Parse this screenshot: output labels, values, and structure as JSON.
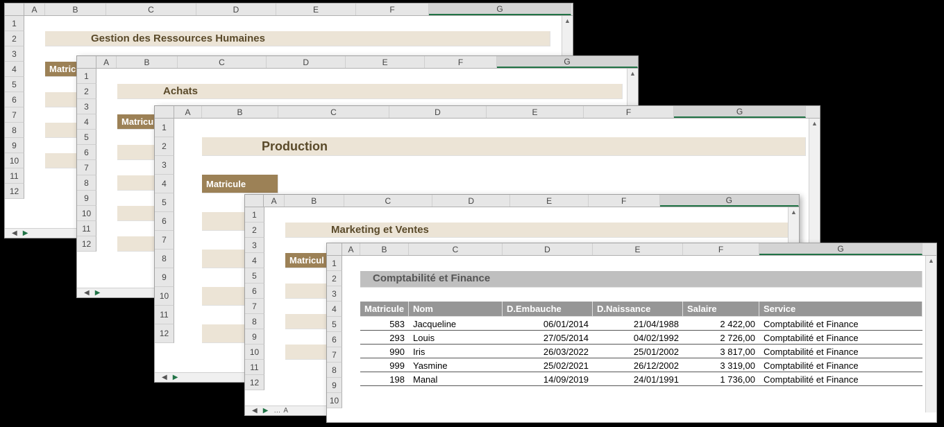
{
  "columns": [
    "A",
    "B",
    "C",
    "D",
    "E",
    "F",
    "G"
  ],
  "rows12": [
    "1",
    "2",
    "3",
    "4",
    "5",
    "6",
    "7",
    "8",
    "9",
    "10",
    "11",
    "12"
  ],
  "rows10": [
    "1",
    "2",
    "3",
    "4",
    "5",
    "6",
    "7",
    "8",
    "9",
    "10"
  ],
  "w1": {
    "title": "Gestion des Ressources Humaines",
    "header_b": "Matricule"
  },
  "w2": {
    "title": "Achats",
    "header_b": "Matricule"
  },
  "w3": {
    "title": "Production",
    "header_b": "Matricule"
  },
  "w4": {
    "title": "Marketing et Ventes",
    "header_b": "Matricul"
  },
  "w5": {
    "title": "Comptabilité et Finance",
    "headers": {
      "b": "Matricule",
      "c": "Nom",
      "d": "D.Embauche",
      "e": "D.Naissance",
      "f": "Salaire",
      "g": "Service"
    },
    "rows": [
      {
        "mat": "583",
        "nom": "Jacqueline",
        "emb": "06/01/2014",
        "nai": "21/04/1988",
        "sal": "2 422,00",
        "srv": "Comptabilité et Finance"
      },
      {
        "mat": "293",
        "nom": "Louis",
        "emb": "27/05/2014",
        "nai": "04/02/1992",
        "sal": "2 726,00",
        "srv": "Comptabilité et Finance"
      },
      {
        "mat": "990",
        "nom": "Iris",
        "emb": "26/03/2022",
        "nai": "25/01/2002",
        "sal": "3 817,00",
        "srv": "Comptabilité et Finance"
      },
      {
        "mat": "999",
        "nom": "Yasmine",
        "emb": "25/02/2021",
        "nai": "26/12/2002",
        "sal": "3 319,00",
        "srv": "Comptabilité et Finance"
      },
      {
        "mat": "198",
        "nom": "Manal",
        "emb": "14/09/2019",
        "nai": "24/01/1991",
        "sal": "1 736,00",
        "srv": "Comptabilité et Finance"
      }
    ]
  },
  "tabbar": {
    "tab_a": "A"
  }
}
